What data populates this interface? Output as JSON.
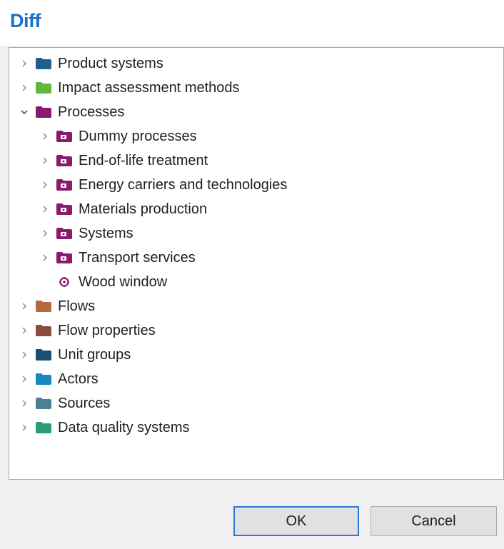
{
  "dialog": {
    "title": "Diff",
    "accent_color": "#1a6fc9"
  },
  "tree": {
    "items": [
      {
        "label": "Product systems",
        "level": 0,
        "expanded": false,
        "has_children": true,
        "icon": "folder-icon",
        "color": "#1f5f8b"
      },
      {
        "label": "Impact assessment methods",
        "level": 0,
        "expanded": false,
        "has_children": true,
        "icon": "folder-icon",
        "color": "#5fb83a"
      },
      {
        "label": "Processes",
        "level": 0,
        "expanded": true,
        "has_children": true,
        "icon": "folder-icon",
        "color": "#8b1a6e"
      },
      {
        "label": "Dummy processes",
        "level": 1,
        "expanded": false,
        "has_children": true,
        "icon": "process-folder-icon",
        "color": "#8b1a6e"
      },
      {
        "label": "End-of-life treatment",
        "level": 1,
        "expanded": false,
        "has_children": true,
        "icon": "process-folder-icon",
        "color": "#8b1a6e"
      },
      {
        "label": "Energy carriers and technologies",
        "level": 1,
        "expanded": false,
        "has_children": true,
        "icon": "process-folder-icon",
        "color": "#8b1a6e"
      },
      {
        "label": "Materials production",
        "level": 1,
        "expanded": false,
        "has_children": true,
        "icon": "process-folder-icon",
        "color": "#8b1a6e"
      },
      {
        "label": "Systems",
        "level": 1,
        "expanded": false,
        "has_children": true,
        "icon": "process-folder-icon",
        "color": "#8b1a6e"
      },
      {
        "label": "Transport services",
        "level": 1,
        "expanded": false,
        "has_children": true,
        "icon": "process-folder-icon",
        "color": "#8b1a6e"
      },
      {
        "label": "Wood window",
        "level": 1,
        "expanded": false,
        "has_children": false,
        "icon": "process-gear-icon",
        "color": "#8b1a6e"
      },
      {
        "label": "Flows",
        "level": 0,
        "expanded": false,
        "has_children": true,
        "icon": "folder-icon",
        "color": "#b56a3e"
      },
      {
        "label": "Flow properties",
        "level": 0,
        "expanded": false,
        "has_children": true,
        "icon": "folder-icon",
        "color": "#8b4a3a"
      },
      {
        "label": "Unit groups",
        "level": 0,
        "expanded": false,
        "has_children": true,
        "icon": "folder-icon",
        "color": "#1b4f6e"
      },
      {
        "label": "Actors",
        "level": 0,
        "expanded": false,
        "has_children": true,
        "icon": "folder-icon",
        "color": "#1b86c0"
      },
      {
        "label": "Sources",
        "level": 0,
        "expanded": false,
        "has_children": true,
        "icon": "folder-icon",
        "color": "#4e7f93"
      },
      {
        "label": "Data quality systems",
        "level": 0,
        "expanded": false,
        "has_children": true,
        "icon": "folder-icon",
        "color": "#2a9c7a"
      }
    ]
  },
  "buttons": {
    "ok_label": "OK",
    "cancel_label": "Cancel"
  }
}
